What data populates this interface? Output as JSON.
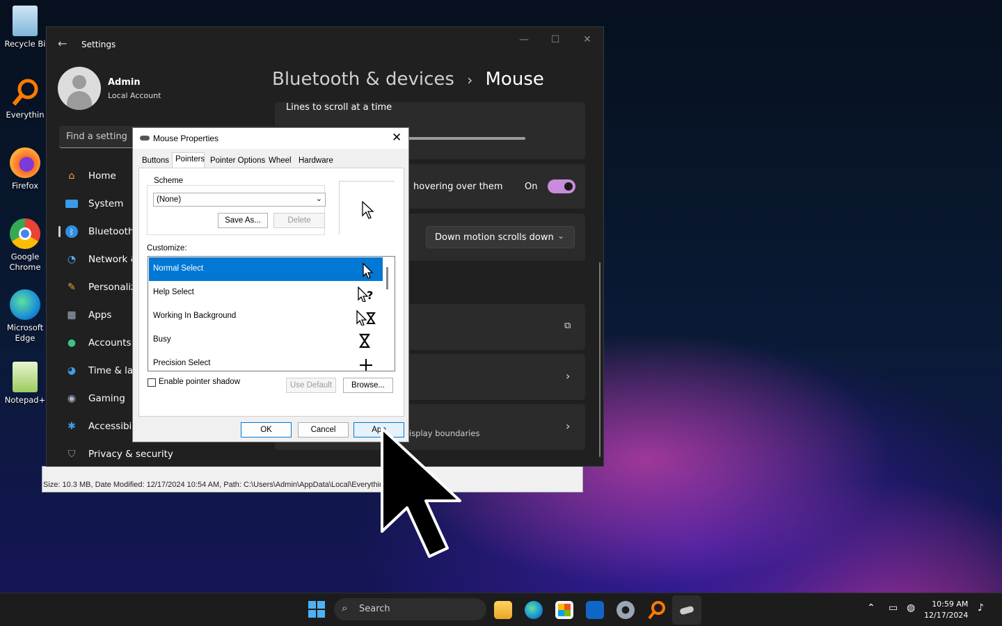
{
  "desktop": {
    "icons": [
      {
        "label": "Recycle Bi"
      },
      {
        "label": "Everythin"
      },
      {
        "label": "Firefox"
      },
      {
        "label": "Google Chrome"
      },
      {
        "label": "Microsoft Edge"
      },
      {
        "label": "Notepad+"
      }
    ]
  },
  "background_window": {
    "status_text": "Size: 10.3 MB, Date Modified: 12/17/2024 10:54 AM, Path: C:\\Users\\Admin\\AppData\\Local\\Everythin"
  },
  "settings": {
    "title": "Settings",
    "window_controls": {
      "minimize": "—",
      "maximize": "☐",
      "close": "✕"
    },
    "user": {
      "name": "Admin",
      "type": "Local Account"
    },
    "search_placeholder": "Find a setting",
    "nav": [
      {
        "label": "Home",
        "icon": "home-icon"
      },
      {
        "label": "System",
        "icon": "system-icon"
      },
      {
        "label": "Bluetooth",
        "icon": "bluetooth-icon",
        "active": true
      },
      {
        "label": "Network &",
        "icon": "wifi-icon"
      },
      {
        "label": "Personaliz",
        "icon": "brush-icon"
      },
      {
        "label": "Apps",
        "icon": "apps-icon"
      },
      {
        "label": "Accounts",
        "icon": "person-icon"
      },
      {
        "label": "Time & lar",
        "icon": "globe-icon"
      },
      {
        "label": "Gaming",
        "icon": "gamepad-icon"
      },
      {
        "label": "Accessibili",
        "icon": "accessibility-icon"
      },
      {
        "label": "Privacy & security",
        "icon": "shield-icon"
      }
    ],
    "breadcrumb": {
      "parent": "Bluetooth & devices",
      "separator": "›",
      "current": "Mouse"
    },
    "content": {
      "lines_to_scroll": "Lines to scroll at a time",
      "hover_scroll": "hovering over them",
      "hover_toggle_state": "On",
      "scroll_direction": "Down motion scrolls down",
      "display_boundaries": "isplay boundaries"
    }
  },
  "mouse_properties": {
    "title": "Mouse Properties",
    "close": "✕",
    "tabs": [
      "Buttons",
      "Pointers",
      "Pointer Options",
      "Wheel",
      "Hardware"
    ],
    "selected_tab": "Pointers",
    "scheme_label": "Scheme",
    "scheme_value": "(None)",
    "save_as": "Save As...",
    "delete": "Delete",
    "customize_label": "Customize:",
    "pointers": [
      {
        "name": "Normal Select",
        "selected": true
      },
      {
        "name": "Help Select"
      },
      {
        "name": "Working In Background"
      },
      {
        "name": "Busy"
      },
      {
        "name": "Precision Select"
      }
    ],
    "pointer_shadow": "Enable pointer shadow",
    "use_default": "Use Default",
    "browse": "Browse...",
    "ok": "OK",
    "cancel": "Cancel",
    "apply": "App"
  },
  "taskbar": {
    "search": "Search",
    "time": "10:59 AM",
    "date": "12/17/2024"
  }
}
